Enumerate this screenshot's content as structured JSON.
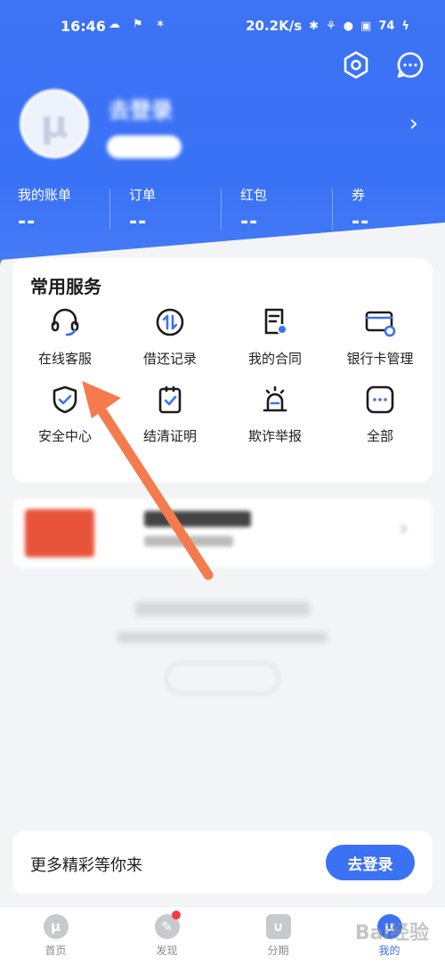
{
  "status_bar": {
    "time": "16:46",
    "speed": "20.2K/s",
    "battery": "74"
  },
  "header": {
    "login_name": "去登录",
    "stats": [
      {
        "label": "我的账单",
        "value": "--"
      },
      {
        "label": "订单",
        "value": "--"
      },
      {
        "label": "红包",
        "value": "--"
      },
      {
        "label": "券",
        "value": "--"
      }
    ]
  },
  "services": {
    "title": "常用服务",
    "items": [
      {
        "label": "在线客服",
        "icon": "headset-icon"
      },
      {
        "label": "借还记录",
        "icon": "transfer-icon"
      },
      {
        "label": "我的合同",
        "icon": "contract-icon"
      },
      {
        "label": "银行卡管理",
        "icon": "bank-card-icon"
      },
      {
        "label": "安全中心",
        "icon": "shield-icon"
      },
      {
        "label": "结清证明",
        "icon": "clipboard-check-icon"
      },
      {
        "label": "欺诈举报",
        "icon": "alarm-icon"
      },
      {
        "label": "全部",
        "icon": "more-icon"
      }
    ]
  },
  "login_bar": {
    "text": "更多精彩等你来",
    "button": "去登录"
  },
  "tabbar": [
    {
      "label": "首页",
      "icon": "home-icon",
      "glyph": "μ"
    },
    {
      "label": "发现",
      "icon": "compass-icon",
      "glyph": "✎"
    },
    {
      "label": "分期",
      "icon": "installment-icon",
      "glyph": "∪"
    },
    {
      "label": "我的",
      "icon": "profile-icon",
      "glyph": "μ"
    }
  ],
  "watermark": "Bai经验",
  "colors": {
    "primary": "#3b71f3",
    "annotation_arrow": "#f47b4e"
  }
}
